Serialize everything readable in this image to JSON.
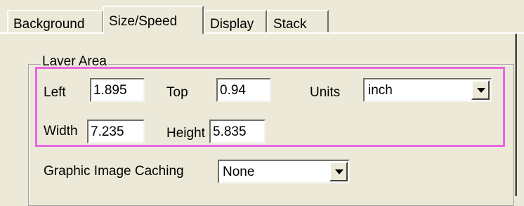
{
  "tabs": [
    {
      "label": "Background",
      "active": false
    },
    {
      "label": "Size/Speed",
      "active": true
    },
    {
      "label": "Display",
      "active": false
    },
    {
      "label": "Stack",
      "active": false
    }
  ],
  "layer_area": {
    "title": "Laver Area",
    "left_label": "Left",
    "left_value": "1.895",
    "top_label": "Top",
    "top_value": "0.94",
    "units_label": "Units",
    "units_value": "inch",
    "width_label": "Width",
    "width_value": "7.235",
    "height_label": "Height",
    "height_value": "5.835"
  },
  "caching": {
    "label": "Graphic Image Caching",
    "value": "None"
  },
  "highlight_color": "#e668e0",
  "icons": {
    "dropdown": "chevron-down-icon"
  }
}
